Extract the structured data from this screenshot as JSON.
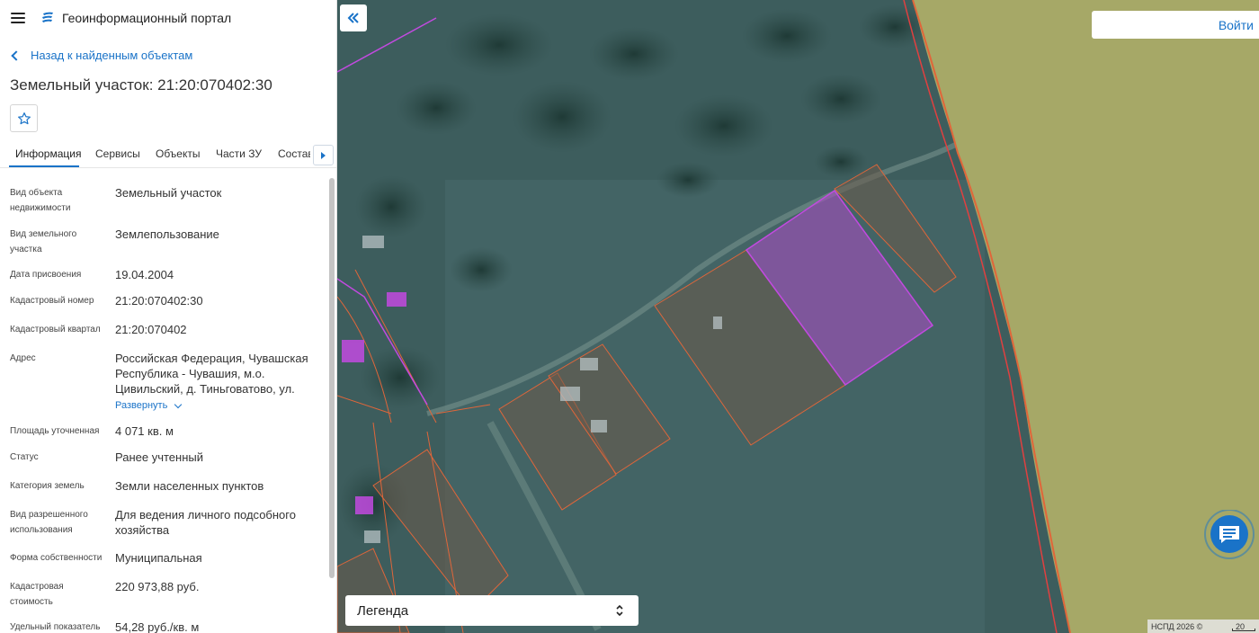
{
  "header": {
    "portal_title": "Геоинформационный портал"
  },
  "back_link": "Назад к найденным объектам",
  "object_title": "Земельный участок: 21:20:070402:30",
  "tabs": [
    {
      "label": "Информация",
      "active": true
    },
    {
      "label": "Сервисы"
    },
    {
      "label": "Объекты"
    },
    {
      "label": "Части ЗУ"
    },
    {
      "label": "Состав"
    }
  ],
  "info": [
    {
      "label": "Вид объекта недвижимости",
      "value": "Земельный участок"
    },
    {
      "label": "Вид земельного участка",
      "value": "Землепользование"
    },
    {
      "label": "Дата присвоения",
      "value": "19.04.2004"
    },
    {
      "label": "Кадастровый номер",
      "value": "21:20:070402:30"
    },
    {
      "label": "Кадастровый квартал",
      "value": "21:20:070402"
    },
    {
      "label": "Адрес",
      "value": "Российская Федерация, Чувашская Республика - Чувашия, м.о. Цивильский, д. Тиньговатово, ул.",
      "expand": "Развернуть"
    },
    {
      "label": "Площадь уточненная",
      "value": "4 071 кв. м"
    },
    {
      "label": "Статус",
      "value": "Ранее учтенный"
    },
    {
      "label": "Категория земель",
      "value": "Земли населенных пунктов"
    },
    {
      "label": "Вид разрешенного использования",
      "value": "Для ведения личного подсобного хозяйства"
    },
    {
      "label": "Форма собственности",
      "value": "Муниципальная"
    },
    {
      "label": "Кадастровая стоимость",
      "value": "220 973,88 руб."
    },
    {
      "label": "Удельный показатель",
      "value": "54,28 руб./кв. м"
    }
  ],
  "map": {
    "login_label": "Войти",
    "legend_label": "Легенда",
    "copyright": "НСПД 2026 ©",
    "scale_label": "20"
  },
  "icons": {
    "menu": "hamburger-icon",
    "logo": "portal-logo-icon",
    "back": "chevron-left-icon",
    "favorite": "star-icon",
    "tab_scroll": "caret-right-icon",
    "collapse": "double-chevron-left-icon",
    "legend_toggle": "updown-chevron-icon",
    "chat": "chat-icon"
  },
  "colors": {
    "accent": "#1a73c8",
    "selected_parcel": "#a64dbf",
    "parcel_border": "#e0663a",
    "field": "#a6a867"
  }
}
